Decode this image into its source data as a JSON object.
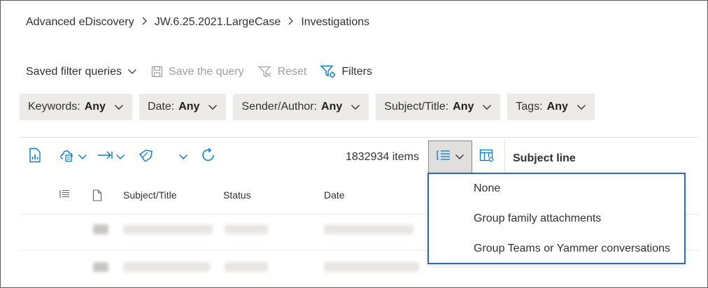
{
  "breadcrumb": [
    {
      "label": "Advanced eDiscovery"
    },
    {
      "label": "JW.6.25.2021.LargeCase"
    },
    {
      "label": "Investigations"
    }
  ],
  "query_bar": {
    "saved_filter_queries": "Saved filter queries",
    "save_query": "Save the query",
    "reset": "Reset",
    "filters": "Filters"
  },
  "filters": [
    {
      "label": "Keywords:",
      "value": "Any"
    },
    {
      "label": "Date:",
      "value": "Any"
    },
    {
      "label": "Sender/Author:",
      "value": "Any"
    },
    {
      "label": "Subject/Title:",
      "value": "Any"
    },
    {
      "label": "Tags:",
      "value": "Any"
    }
  ],
  "toolbar": {
    "items_count": "1832934 items",
    "reading_pane_label": "Subject line"
  },
  "table": {
    "columns": [
      "Subject/Title",
      "Status",
      "Date"
    ]
  },
  "group_menu": {
    "options": [
      "None",
      "Group family attachments",
      "Group Teams or Yammer conversations"
    ]
  },
  "colors": {
    "accent": "#0078d4",
    "pill_bg": "#edebe9",
    "dropdown_border": "#2f6aa6",
    "disabled": "#a19f9d"
  },
  "icons": [
    "chevron-right-icon",
    "chevron-down-icon",
    "save-icon",
    "filter-clear-icon",
    "filter-settings-icon",
    "report-icon",
    "tag-icon",
    "export-icon",
    "refresh-icon",
    "group-list-icon",
    "column-options-icon",
    "document-icon"
  ]
}
